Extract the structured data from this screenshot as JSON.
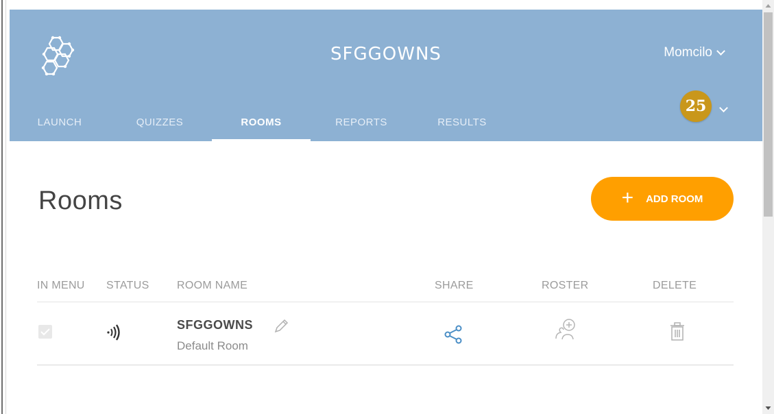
{
  "header": {
    "app_title": "SFGGOWNS",
    "user_name": "Momcilo",
    "badge_count": "25",
    "brand_color": "#8db1d3"
  },
  "tabs": [
    {
      "label": "LAUNCH",
      "active": false
    },
    {
      "label": "QUIZZES",
      "active": false
    },
    {
      "label": "ROOMS",
      "active": true
    },
    {
      "label": "REPORTS",
      "active": false
    },
    {
      "label": "RESULTS",
      "active": false
    }
  ],
  "page": {
    "title": "Rooms",
    "add_button_label": "ADD ROOM",
    "add_button_color": "#ff9f00"
  },
  "table": {
    "headers": {
      "in_menu": "IN MENU",
      "status": "STATUS",
      "room_name": "ROOM NAME",
      "share": "SHARE",
      "roster": "ROSTER",
      "delete": "DELETE"
    },
    "rows": [
      {
        "in_menu_checked": true,
        "status_icon": "broadcast-icon",
        "room_name": "SFGGOWNS",
        "room_subtitle": "Default Room",
        "share_icon": "share-icon",
        "roster_icon": "add-roster-icon",
        "delete_icon": "trash-icon"
      }
    ]
  },
  "icons": {
    "logo": "hexagon-logo-icon",
    "user_menu": "chevron-down-icon"
  }
}
